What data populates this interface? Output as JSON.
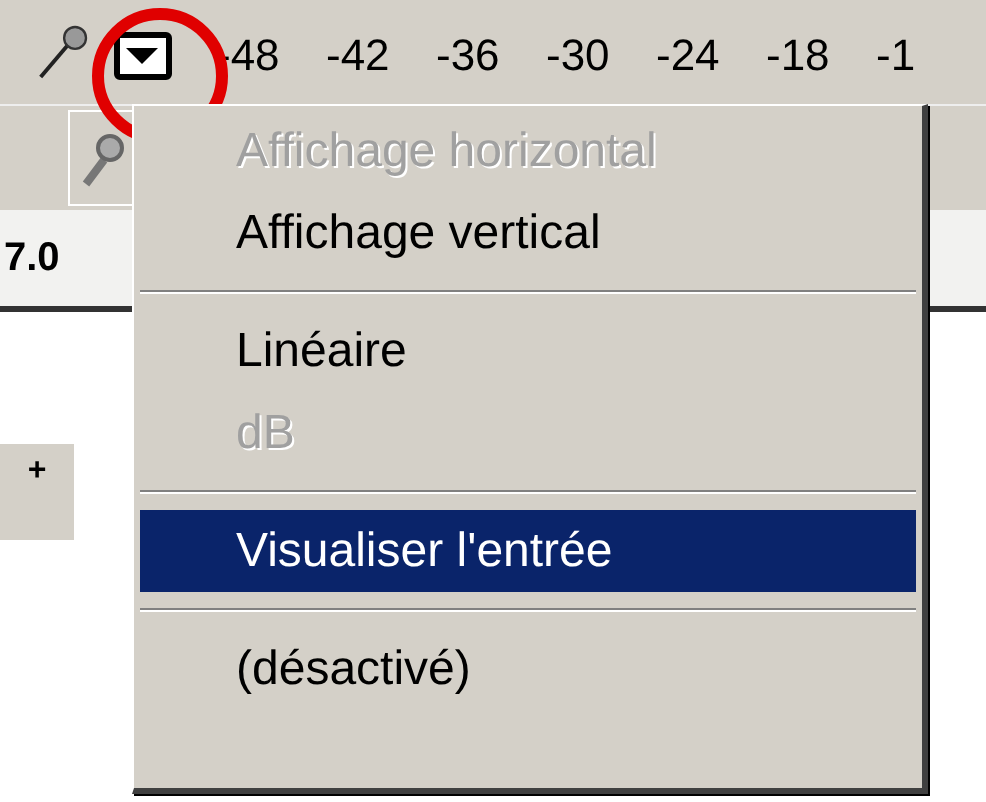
{
  "meter_toolbar": {
    "scale": [
      "-48",
      "-42",
      "-36",
      "-30",
      "-24",
      "-18",
      "-1"
    ]
  },
  "ruler": {
    "label": "7.0"
  },
  "zoom_button": {
    "label": "+"
  },
  "menu": [
    {
      "kind": "item",
      "label": "Affichage horizontal",
      "disabled": true,
      "selected": false
    },
    {
      "kind": "item",
      "label": "Affichage vertical",
      "disabled": false,
      "selected": false
    },
    {
      "kind": "separator"
    },
    {
      "kind": "item",
      "label": "Linéaire",
      "disabled": false,
      "selected": false
    },
    {
      "kind": "item",
      "label": "dB",
      "disabled": true,
      "selected": false
    },
    {
      "kind": "separator"
    },
    {
      "kind": "item",
      "label": "Visualiser l'entrée",
      "disabled": false,
      "selected": true
    },
    {
      "kind": "separator"
    },
    {
      "kind": "item",
      "label": "(désactivé)",
      "disabled": false,
      "selected": false
    }
  ]
}
